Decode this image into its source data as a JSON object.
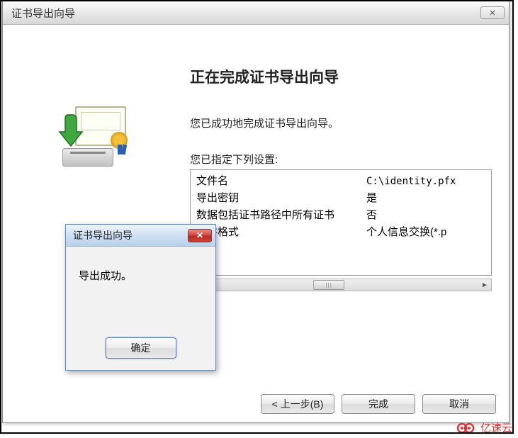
{
  "window": {
    "title": "证书导出向导"
  },
  "main": {
    "heading": "正在完成证书导出向导",
    "description": "您已成功地完成证书导出向导。",
    "settings_label": "您已指定下列设置:",
    "rows": [
      {
        "label": "文件名",
        "value": "C:\\identity.pfx"
      },
      {
        "label": "导出密钥",
        "value": "是"
      },
      {
        "label": "数据包括证书路径中所有证书",
        "value": "否"
      },
      {
        "label": "文件格式",
        "value": "个人信息交换(*.p"
      }
    ]
  },
  "buttons": {
    "back": "< 上一步(B)",
    "finish": "完成",
    "cancel": "取消"
  },
  "dialog": {
    "title": "证书导出向导",
    "message": "导出成功。",
    "ok": "确定"
  },
  "watermark": {
    "text": "亿速云"
  }
}
